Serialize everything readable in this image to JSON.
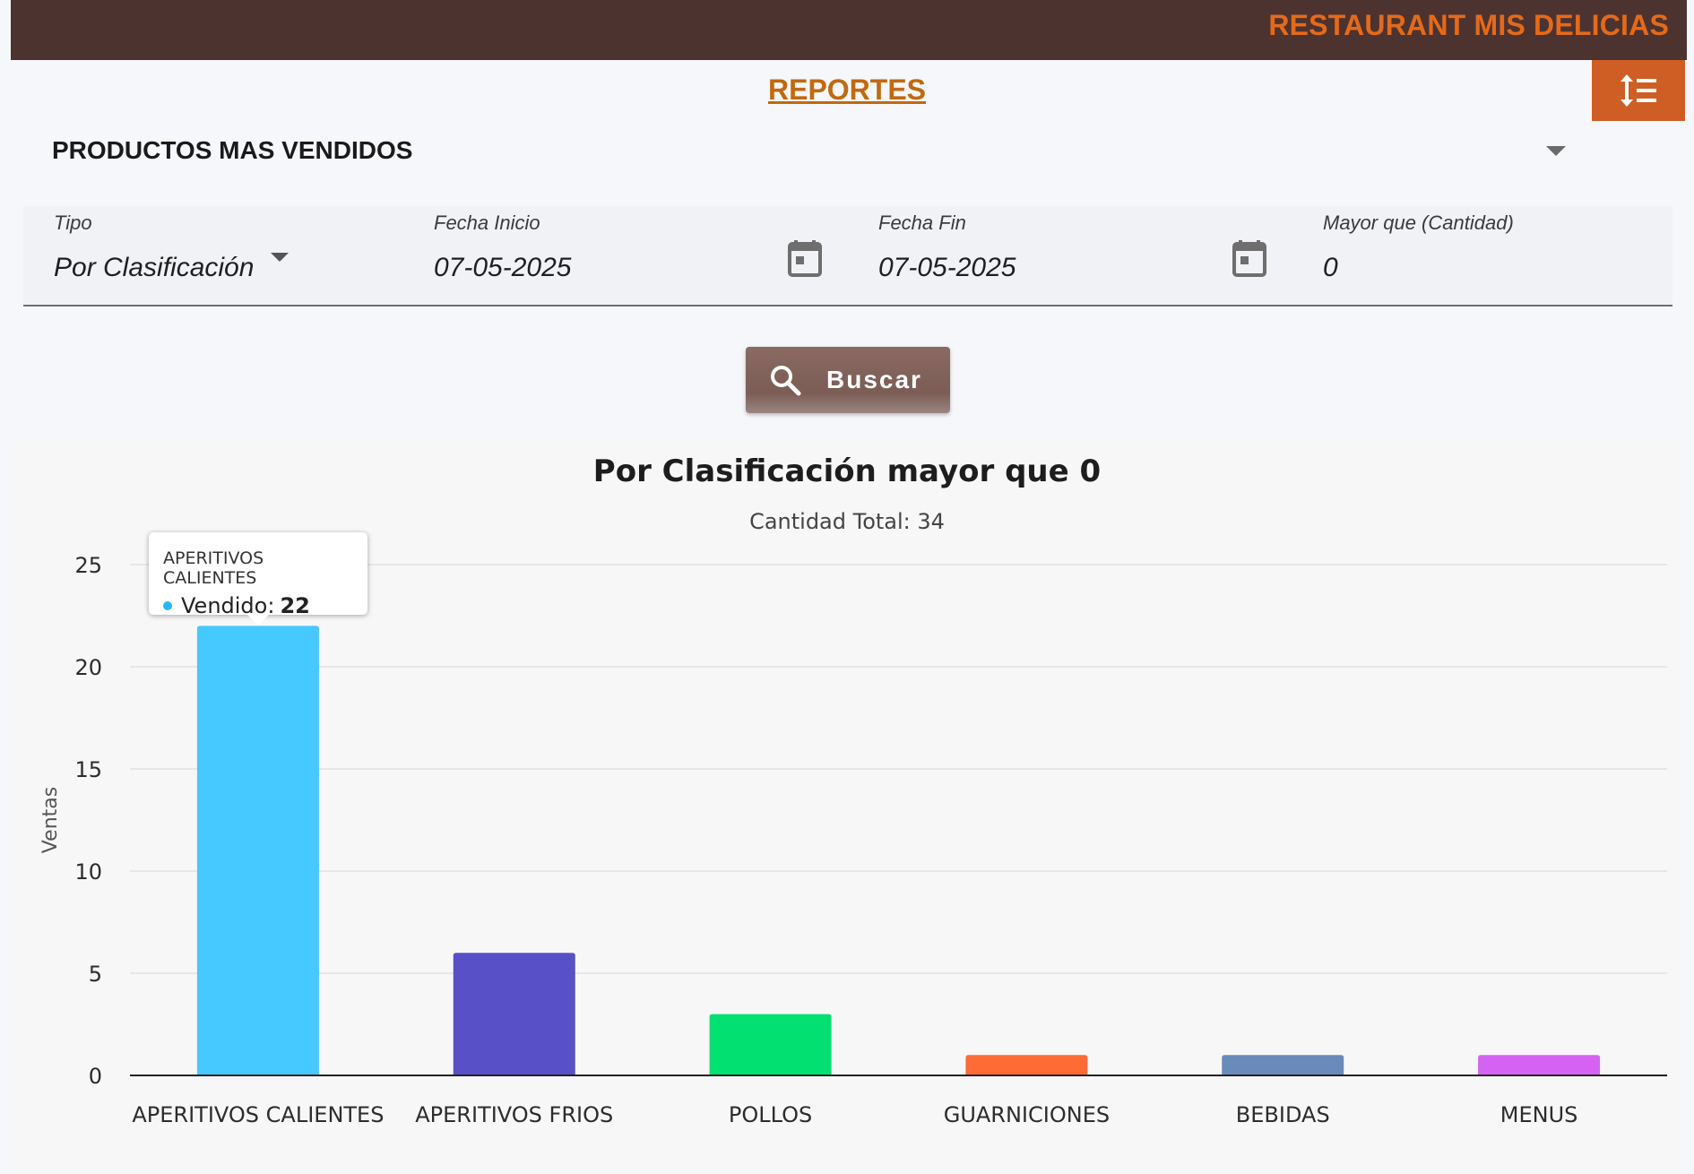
{
  "header": {
    "brand": "RESTAURANT MIS DELICIAS",
    "page_title": "REPORTES"
  },
  "section": {
    "title": "PRODUCTOS MAS VENDIDOS"
  },
  "filters": {
    "tipo_label": "Tipo",
    "tipo_value": "Por Clasificación",
    "fecha_inicio_label": "Fecha Inicio",
    "fecha_inicio_value": "07-05-2025",
    "fecha_fin_label": "Fecha Fin",
    "fecha_fin_value": "07-05-2025",
    "mayor_que_label": "Mayor que (Cantidad)",
    "mayor_que_value": "0"
  },
  "actions": {
    "buscar_label": "Buscar"
  },
  "tooltip": {
    "title": "APERITIVOS CALIENTES",
    "series_label": "Vendido:",
    "value": "22"
  },
  "colors": {
    "topbar": "#4d3330",
    "brand": "#e46a1a",
    "accent_button": "#cf5e25",
    "buscar_button": "#7b5d56"
  },
  "icons": {
    "menu_toggle": "list-sort-icon",
    "calendar": "calendar-icon",
    "search": "search-icon"
  },
  "chart_data": {
    "type": "bar",
    "title": "Por Clasificación mayor que 0",
    "subtitle": "Cantidad Total: 34",
    "xlabel": "",
    "ylabel": "Ventas",
    "ylim": [
      0,
      25
    ],
    "yticks": [
      0,
      5,
      10,
      15,
      20,
      25
    ],
    "grid": true,
    "categories": [
      "APERITIVOS CALIENTES",
      "APERITIVOS FRIOS",
      "POLLOS",
      "GUARNICIONES",
      "BEBIDAS",
      "MENUS"
    ],
    "series": [
      {
        "name": "Vendido",
        "values": [
          22,
          6,
          3,
          1,
          1,
          1
        ],
        "colors": [
          "#45c9ff",
          "#5750c6",
          "#02e072",
          "#ff6b35",
          "#6a8abc",
          "#d563f2"
        ]
      }
    ]
  }
}
